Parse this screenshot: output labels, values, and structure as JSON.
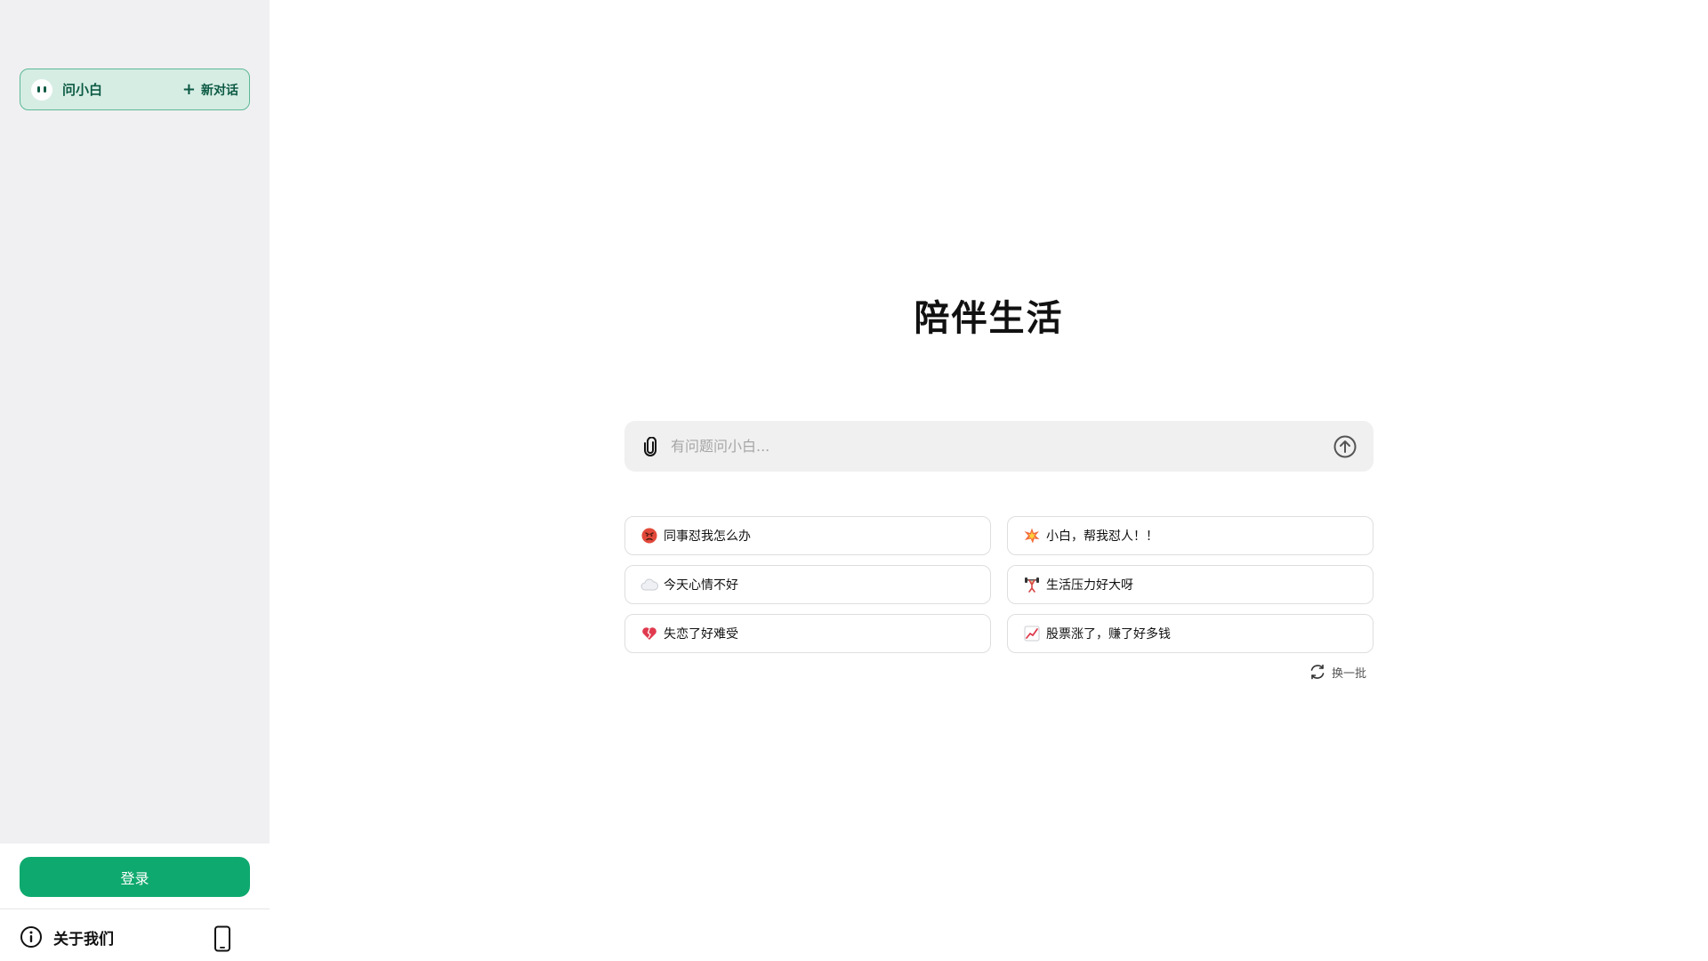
{
  "sidebar": {
    "brand_name": "问小白",
    "new_chat_label": "新对话",
    "login_label": "登录",
    "about_label": "关于我们"
  },
  "main": {
    "title": "陪伴生活",
    "input_placeholder": "有问题问小白...",
    "refresh_label": "换一批"
  },
  "suggestions": [
    {
      "icon": "angry-face-icon",
      "label": "同事怼我怎么办"
    },
    {
      "icon": "collision-icon",
      "label": "小白，帮我怼人！！"
    },
    {
      "icon": "cloud-icon",
      "label": "今天心情不好"
    },
    {
      "icon": "weightlifting-icon",
      "label": "生活压力好大呀"
    },
    {
      "icon": "broken-heart-icon",
      "label": "失恋了好难受"
    },
    {
      "icon": "chart-increasing-icon",
      "label": "股票涨了，赚了好多钱"
    }
  ],
  "colors": {
    "brand_bg": "#d6ede4",
    "brand_border": "#5cb896",
    "brand_text": "#0c5a43",
    "login_button": "#0ea96e",
    "sidebar_bg": "#f0f0f2"
  }
}
